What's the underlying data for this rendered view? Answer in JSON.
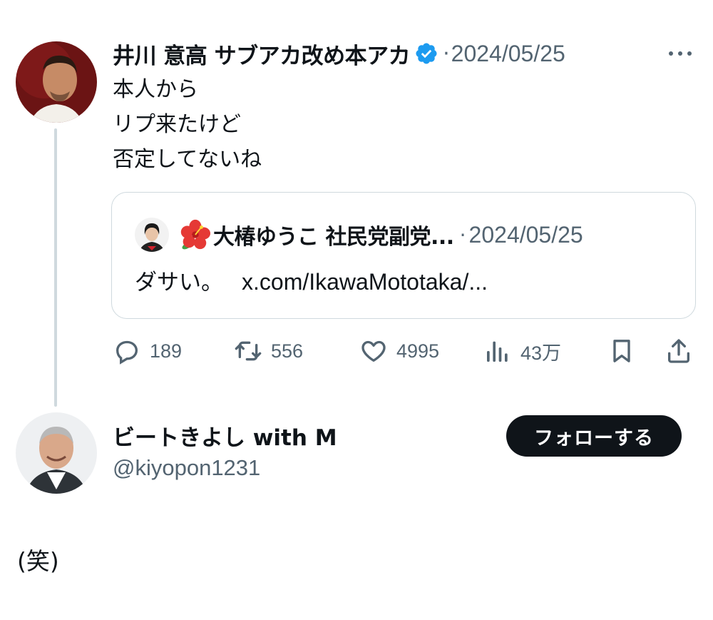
{
  "tweet": {
    "author_name": "井川 意高 サブアカ改め本アカ",
    "verified": true,
    "separator": "·",
    "date": "2024/05/25",
    "more_icon": "more-horizontal-icon",
    "body_lines": [
      "本人から",
      "リプ来たけど",
      "否定してないね"
    ]
  },
  "quote": {
    "emoji": "🌺",
    "author_name": "大椿ゆうこ 社民党副党...",
    "separator": "·",
    "date": "2024/05/25",
    "text": "ダサい。",
    "link": "x.com/IkawaMototaka/..."
  },
  "actions": {
    "replies": {
      "icon": "reply-icon",
      "count": "189"
    },
    "retweets": {
      "icon": "retweet-icon",
      "count": "556"
    },
    "likes": {
      "icon": "heart-icon",
      "count": "4995"
    },
    "views": {
      "icon": "views-chart-icon",
      "count": "43万"
    },
    "bookmark": {
      "icon": "bookmark-icon"
    },
    "share": {
      "icon": "share-icon"
    }
  },
  "reply": {
    "author_name": "ビートきよし with M",
    "handle": "@kiyopon1231",
    "follow_label": "フォローする",
    "text": "(笑)"
  },
  "colors": {
    "text": "#0f1419",
    "muted": "#536471",
    "verified": "#1d9bf0",
    "border": "#cfd9de",
    "button_bg": "#0f1419"
  }
}
